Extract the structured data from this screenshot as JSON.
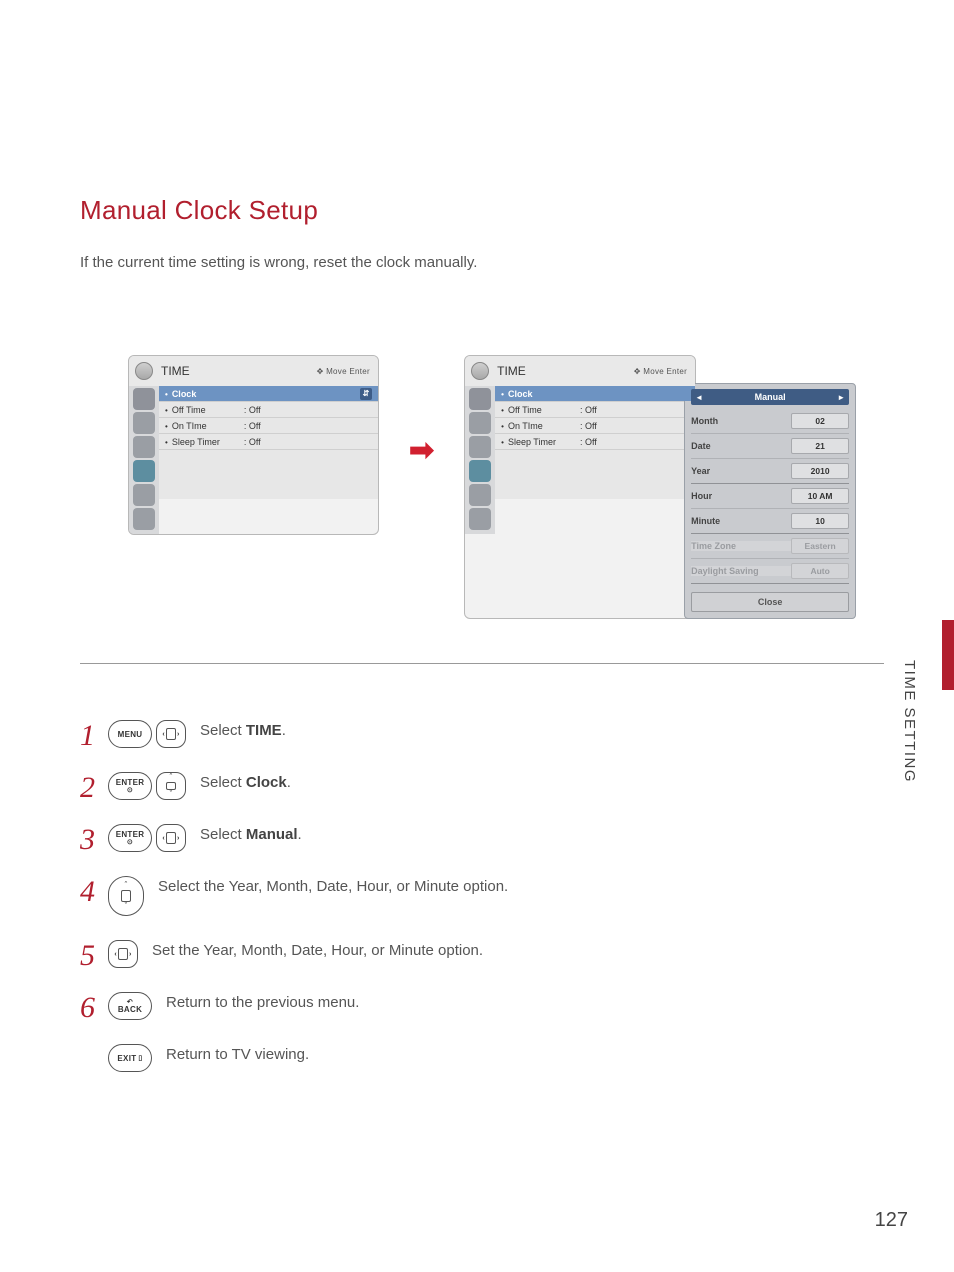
{
  "heading": "Manual Clock Setup",
  "intro": "If the current time setting is wrong, reset the clock manually.",
  "side_label": "TIME SETTING",
  "page_number": "127",
  "osd": {
    "title": "TIME",
    "hints": "Move    Enter",
    "rows": [
      {
        "label": "Clock",
        "value": ""
      },
      {
        "label": "Off Time",
        "value": "Off"
      },
      {
        "label": "On TIme",
        "value": "Off"
      },
      {
        "label": "Sleep Timer",
        "value": "Off"
      }
    ]
  },
  "manual": {
    "header": "Manual",
    "rows": [
      {
        "label": "Month",
        "value": "02"
      },
      {
        "label": "Date",
        "value": "21"
      },
      {
        "label": "Year",
        "value": "2010"
      },
      {
        "label": "Hour",
        "value": "10 AM"
      },
      {
        "label": "Minute",
        "value": "10"
      },
      {
        "label": "Time Zone",
        "value": "Eastern"
      },
      {
        "label": "Daylight Saving",
        "value": "Auto"
      }
    ],
    "close": "Close"
  },
  "buttons": {
    "menu": "MENU",
    "enter": "ENTER",
    "back": "BACK",
    "exit": "EXIT"
  },
  "steps": {
    "s1a": "Select ",
    "s1b": "TIME",
    "s1c": ".",
    "s2a": "Select ",
    "s2b": "Clock",
    "s2c": ".",
    "s3a": "Select ",
    "s3b": "Manual",
    "s3c": ".",
    "s4": "Select the Year, Month, Date, Hour, or Minute option.",
    "s5": "Set the Year, Month, Date, Hour, or Minute option.",
    "s6": "Return to the previous menu.",
    "s7": "Return to TV viewing."
  }
}
